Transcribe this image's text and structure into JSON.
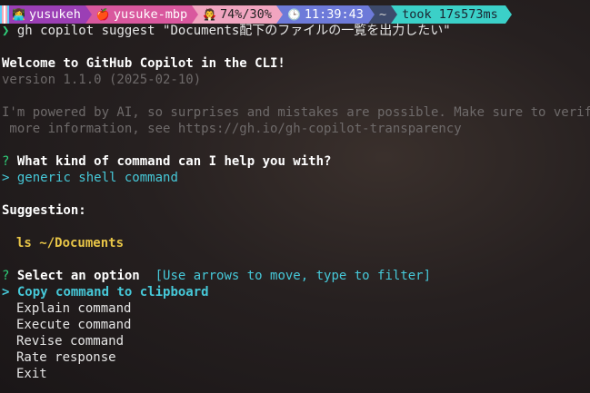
{
  "statusbar": {
    "user_icon": "👩‍💻",
    "user": "yusukeh",
    "host_icon": "🍎",
    "host": "yusuke-mbp",
    "battery_icon": "🧛",
    "battery": "74%/30%",
    "clock_icon": "🕒",
    "time": "11:39:43",
    "dir": "~",
    "took": "took 17s573ms"
  },
  "command": {
    "chevron": "❯",
    "text": "gh copilot suggest \"Documents配下のファイルの一覧を出力したい\""
  },
  "welcome": {
    "title": "Welcome to GitHub Copilot in the CLI!",
    "version": "version 1.1.0 (2025-02-10)"
  },
  "disclaimer": {
    "line1": "I'm powered by AI, so surprises and mistakes are possible. Make sure to verify an",
    "line2": " more information, see https://gh.io/gh-copilot-transparency"
  },
  "question1": {
    "mark": "?",
    "text": "What kind of command can I help you with?",
    "answer_marker": ">",
    "answer": "generic shell command"
  },
  "suggestion": {
    "heading": "Suggestion:",
    "command": "ls ~/Documents"
  },
  "option_prompt": {
    "mark": "?",
    "text": "Select an option",
    "hint": "[Use arrows to move, type to filter]",
    "marker": ">",
    "options": [
      "Copy command to clipboard",
      "Explain command",
      "Execute command",
      "Revise command",
      "Rate response",
      "Exit"
    ],
    "selected_index": 0
  },
  "colors": {
    "accent_green": "#2fd07a",
    "accent_cyan": "#46c8d8",
    "suggestion_yellow": "#e8c547"
  }
}
